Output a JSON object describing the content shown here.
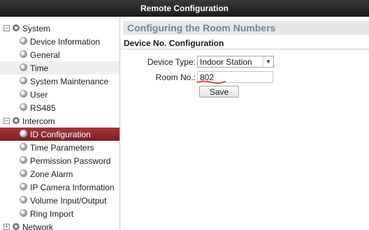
{
  "window": {
    "title": "Remote Configuration"
  },
  "sidebar": {
    "groups": [
      {
        "label": "System",
        "expanded_symbol": "−"
      },
      {
        "label": "Intercom",
        "expanded_symbol": "−"
      },
      {
        "label": "Network",
        "expanded_symbol": "+"
      }
    ],
    "system_items": [
      {
        "label": "Device Information"
      },
      {
        "label": "General"
      },
      {
        "label": "Time"
      },
      {
        "label": "System Maintenance"
      },
      {
        "label": "User"
      },
      {
        "label": "RS485"
      }
    ],
    "intercom_items": [
      {
        "label": "ID Configuration"
      },
      {
        "label": "Time Parameters"
      },
      {
        "label": "Permission Password"
      },
      {
        "label": "Zone Alarm"
      },
      {
        "label": "IP Camera Information"
      },
      {
        "label": "Volume Input/Output"
      },
      {
        "label": "Ring Import"
      }
    ]
  },
  "main": {
    "banner": "Configuring the Room Numbers",
    "section_title": "Device No. Configuration",
    "device_type": {
      "label": "Device Type:",
      "value": "Indoor Station"
    },
    "room_no": {
      "label": "Room No.:",
      "value": "802"
    },
    "save_label": "Save"
  },
  "colors": {
    "active_item": "#8e2a30",
    "banner_text": "#6e86a3",
    "annotation_underline": "#d03030"
  }
}
